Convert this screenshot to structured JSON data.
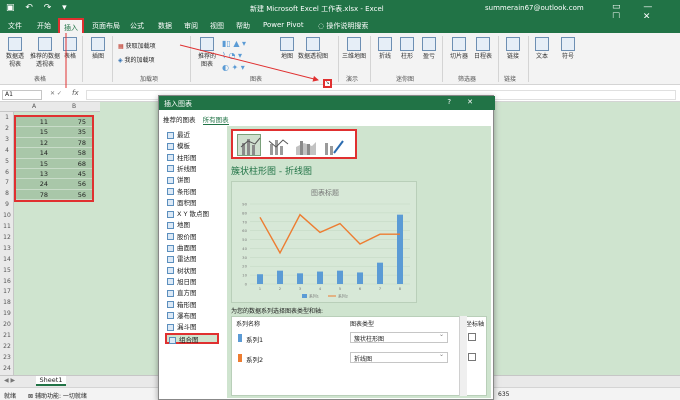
{
  "window": {
    "title": "新建 Microsoft Excel 工作表.xlsx  -  Excel",
    "user": "summerain67@outlook.com",
    "quick_access": "▣ ↶ ↷ ▾",
    "controls": "▭ — ☐ ✕"
  },
  "tabs": [
    "文件",
    "开始",
    "插入",
    "页面布局",
    "公式",
    "数据",
    "审阅",
    "视图",
    "帮助",
    "Power Pivot"
  ],
  "tell_me": "操作说明搜索",
  "ribbon": {
    "pivot_table": "数据透视表",
    "recommended_pivot": "推荐的数据透视表",
    "table": "表格",
    "group_tables": "表格",
    "illustrations": "插图",
    "get_addins": "获取加载项",
    "my_addins": "我的加载项",
    "group_addins": "加载项",
    "recommended_charts": "推荐的图表",
    "maps": "地图",
    "pivot_chart": "数据透视图",
    "group_charts": "图表",
    "map3d": "三维地图",
    "group_tours": "演示",
    "line": "折线",
    "column": "柱形",
    "winloss": "盈亏",
    "group_sparklines": "迷你图",
    "slicer": "切片器",
    "timeline": "日程表",
    "group_filters": "筛选器",
    "link": "链接",
    "group_links": "链接",
    "text": "文本",
    "symbol": "符号"
  },
  "formula_bar": {
    "name_box": "A1",
    "fx": "fx"
  },
  "columns": [
    "A",
    "B"
  ],
  "rows": [
    "1",
    "2",
    "3",
    "4",
    "5",
    "6",
    "7",
    "8",
    "9",
    "10",
    "11",
    "12",
    "13",
    "14",
    "15",
    "16",
    "17",
    "18",
    "19",
    "20",
    "21",
    "22",
    "23",
    "24"
  ],
  "cells": [
    [
      "11",
      "75"
    ],
    [
      "15",
      "35"
    ],
    [
      "12",
      "78"
    ],
    [
      "14",
      "58"
    ],
    [
      "15",
      "68"
    ],
    [
      "13",
      "45"
    ],
    [
      "24",
      "56"
    ],
    [
      "78",
      "56"
    ]
  ],
  "sheet_tab": "Sheet1",
  "status": {
    "ready": "就绪",
    "accessibility": "辅助功能: 一切就绪",
    "zoom": "635"
  },
  "dialog": {
    "title": "插入图表",
    "help": "?",
    "close": "✕",
    "tab_recommended": "推荐的图表",
    "tab_all": "所有图表",
    "chart_types": [
      "最近",
      "模板",
      "柱形图",
      "折线图",
      "饼图",
      "条形图",
      "面积图",
      "X Y 散点图",
      "地图",
      "股价图",
      "曲面图",
      "雷达图",
      "树状图",
      "旭日图",
      "直方图",
      "箱形图",
      "瀑布图",
      "漏斗图",
      "组合图"
    ],
    "chart_heading": "簇状柱形图 - 折线图",
    "instruction": "为您的数据系列选择图表类型和轴:",
    "headers": {
      "series_name": "系列名称",
      "chart_type": "图表类型",
      "secondary_axis": "次坐标轴"
    },
    "series": [
      {
        "name": "系列1",
        "type": "簇状柱形图",
        "color": "#5b9bd5"
      },
      {
        "name": "系列2",
        "type": "折线图",
        "color": "#ed7d31"
      }
    ]
  },
  "colors": {
    "excel_green": "#217346",
    "highlight": "#e03030"
  },
  "chart_data": {
    "type": "bar",
    "title": "图表标题",
    "categories": [
      "1",
      "2",
      "3",
      "4",
      "5",
      "6",
      "7",
      "8"
    ],
    "y_ticks": [
      "90",
      "80",
      "70",
      "60",
      "50",
      "40",
      "30",
      "20",
      "10",
      "0"
    ],
    "ylim": [
      0,
      90
    ],
    "series": [
      {
        "name": "系列1",
        "kind": "bar",
        "values": [
          11,
          15,
          12,
          14,
          15,
          13,
          24,
          78
        ]
      },
      {
        "name": "系列2",
        "kind": "line",
        "values": [
          75,
          35,
          78,
          58,
          68,
          45,
          56,
          56
        ]
      }
    ],
    "legend_position": "bottom",
    "grid": true
  }
}
